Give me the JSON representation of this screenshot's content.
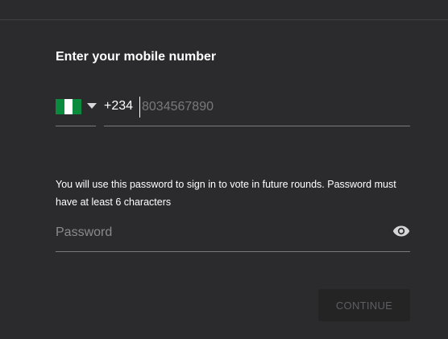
{
  "form": {
    "title": "Enter your mobile number",
    "country": {
      "flag_icon": "nigeria-flag-icon",
      "dial_code": "+234"
    },
    "phone": {
      "value": "",
      "placeholder": "8034567890"
    },
    "help_text": "You will use this password to sign in to vote in future rounds. Password must have at least 6 characters",
    "password": {
      "value": "",
      "placeholder": "Password",
      "toggle_icon": "eye-icon"
    },
    "continue_label": "CONTINUE"
  },
  "colors": {
    "background": "#2b2b2d",
    "flag_green": "#0a8a3c",
    "button_background": "#242425",
    "button_text_disabled": "#5e5e62"
  }
}
